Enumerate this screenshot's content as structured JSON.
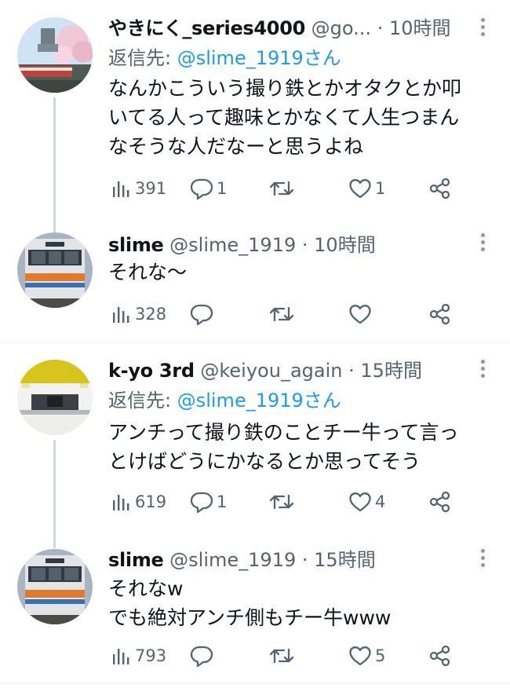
{
  "tweets": [
    {
      "name": "やきにく_series4000",
      "handle": "@go...",
      "time": "10時間",
      "reply_prefix": "返信先: ",
      "reply_mention": "@slime_1919さん",
      "lines": [
        "なんかこういう撮り鉄とかオタクとか叩",
        "いてる人って趣味とかなくて人生つまん",
        "なそうな人だなーと思うよね"
      ],
      "views": "391",
      "replies": "1",
      "retweets": "",
      "likes": "1"
    },
    {
      "name": "slime",
      "handle": "@slime_1919",
      "time": "10時間",
      "lines": [
        "それな〜"
      ],
      "views": "328",
      "replies": "",
      "retweets": "",
      "likes": ""
    },
    {
      "name": "k-yo 3rd",
      "handle": "@keiyou_again",
      "time": "15時間",
      "reply_prefix": "返信先: ",
      "reply_mention": "@slime_1919さん",
      "lines": [
        "アンチって撮り鉄のことチー牛って言っ",
        "とけばどうにかなるとか思ってそう"
      ],
      "views": "619",
      "replies": "1",
      "retweets": "",
      "likes": "4"
    },
    {
      "name": "slime",
      "handle": "@slime_1919",
      "time": "15時間",
      "lines": [
        "それなw",
        "でも絶対アンチ側もチー牛www"
      ],
      "views": "793",
      "replies": "",
      "retweets": "",
      "likes": "5"
    }
  ],
  "separator": "·",
  "icons": {
    "views": "bar-chart-icon",
    "reply": "speech-bubble-icon",
    "retweet": "retweet-arrows-icon",
    "like": "heart-icon",
    "share": "share-nodes-icon",
    "more": "vertical-ellipsis-icon"
  },
  "colors": {
    "text": "#0f1419",
    "secondary": "#536471",
    "mention": "#1d9bf0",
    "thread_line": "#cfd9de",
    "divider": "#eff3f4"
  }
}
